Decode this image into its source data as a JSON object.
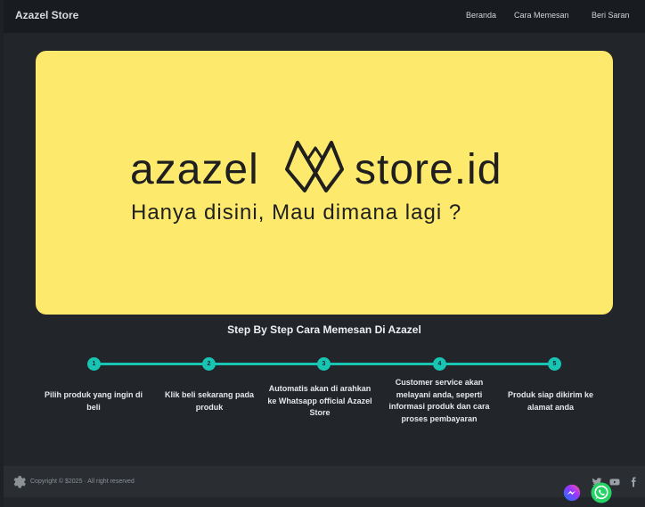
{
  "navbar": {
    "brand": "Azazel Store",
    "links": [
      "Beranda",
      "Cara Memesan",
      "Beri Saran"
    ]
  },
  "hero": {
    "logo_left": "azazel",
    "logo_right": "store.id",
    "tagline": "Hanya disini, Mau dimana lagi ?",
    "background": "#fde96b"
  },
  "steps": {
    "title": "Step By Step Cara Memesan Di Azazel",
    "accent": "#18c4b2",
    "items": [
      {
        "number": "1",
        "text": "Pilih produk yang ingin di beli"
      },
      {
        "number": "2",
        "text": "Klik beli sekarang pada produk"
      },
      {
        "number": "3",
        "text": "Automatis akan di arahkan ke Whatsapp official Azazel Store"
      },
      {
        "number": "4",
        "text": "Customer service akan melayani anda, seperti informasi produk dan cara proses pembayaran"
      },
      {
        "number": "5",
        "text": "Produk siap dikirim ke alamat anda"
      }
    ]
  },
  "footer": {
    "copyright": "Copyright © $2025 · All right reserved",
    "social_icons": [
      "twitter-icon",
      "youtube-icon",
      "facebook-icon"
    ]
  },
  "floating": {
    "messenger": "messenger-icon",
    "whatsapp": "whatsapp-icon"
  }
}
